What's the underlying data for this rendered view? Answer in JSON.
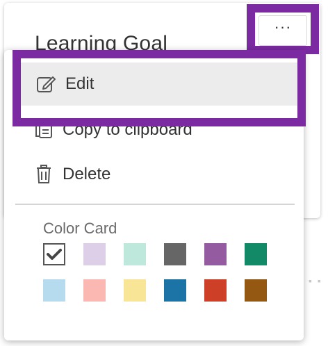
{
  "card": {
    "title": "Learning Goal"
  },
  "more_button": {
    "label": "···"
  },
  "menu": {
    "items": [
      {
        "label": "Edit",
        "icon": "edit-icon"
      },
      {
        "label": "Copy to clipboard",
        "icon": "clipboard-icon"
      },
      {
        "label": "Delete",
        "icon": "trash-icon"
      }
    ],
    "color_section_label": "Color Card",
    "colors": [
      {
        "name": "white",
        "hex": "#ffffff",
        "selected": true
      },
      {
        "name": "lavender",
        "hex": "#ddcfe8"
      },
      {
        "name": "mint",
        "hex": "#bfe8dd"
      },
      {
        "name": "gray",
        "hex": "#666666"
      },
      {
        "name": "purple",
        "hex": "#955ba0"
      },
      {
        "name": "green",
        "hex": "#128a67"
      },
      {
        "name": "light-blue",
        "hex": "#b6dbef"
      },
      {
        "name": "pink",
        "hex": "#fbb8b2"
      },
      {
        "name": "yellow",
        "hex": "#f8e596"
      },
      {
        "name": "blue",
        "hex": "#1c73a5"
      },
      {
        "name": "red",
        "hex": "#cd3f26"
      },
      {
        "name": "brown",
        "hex": "#955812"
      }
    ]
  },
  "focus_color": "#7b2aa1"
}
